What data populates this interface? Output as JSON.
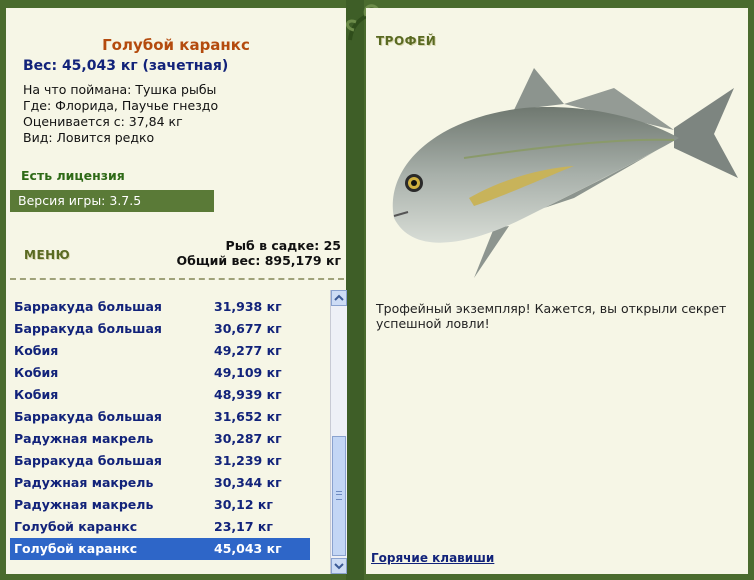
{
  "fish": {
    "title": "Голубой каранкс",
    "weight_line": "Вес: 45,043 кг (зачетная)",
    "bait": "На что поймана: Тушка рыбы",
    "location": "Где: Флорида, Паучье гнездо",
    "value": "Оценивается с: 37,84 кг",
    "rarity": "Вид: Ловится редко"
  },
  "license": "Есть лицензия",
  "version": "Версия игры: 3.7.5",
  "menu_label": "МЕНЮ",
  "stats": {
    "count": "Рыб в садке: 25",
    "total": "Общий вес: 895,179 кг"
  },
  "catch_list": [
    {
      "name": "Барракуда большая",
      "weight": "31,938 кг"
    },
    {
      "name": "Барракуда большая",
      "weight": "30,677 кг"
    },
    {
      "name": "Кобия",
      "weight": "49,277 кг"
    },
    {
      "name": "Кобия",
      "weight": "49,109 кг"
    },
    {
      "name": "Кобия",
      "weight": "48,939 кг"
    },
    {
      "name": "Барракуда большая",
      "weight": "31,652 кг"
    },
    {
      "name": "Радужная макрель",
      "weight": "30,287 кг"
    },
    {
      "name": "Барракуда большая",
      "weight": "31,239 кг"
    },
    {
      "name": "Радужная макрель",
      "weight": "30,344 кг"
    },
    {
      "name": "Радужная макрель",
      "weight": "30,12 кг"
    },
    {
      "name": "Голубой каранкс",
      "weight": "23,17 кг"
    },
    {
      "name": "Голубой каранкс",
      "weight": "45,043 кг",
      "selected": true
    }
  ],
  "trophy": {
    "heading": "ТРОФЕЙ",
    "message": "Трофейный экземпляр! Кажется, вы открыли секрет успешной ловли!"
  },
  "hotkeys_link": "Горячие клавиши",
  "colors": {
    "frame": "#4a6b2e",
    "panel": "#f6f6e6",
    "title": "#b44b0e",
    "list_text": "#12237a",
    "selection": "#2e66c8"
  }
}
